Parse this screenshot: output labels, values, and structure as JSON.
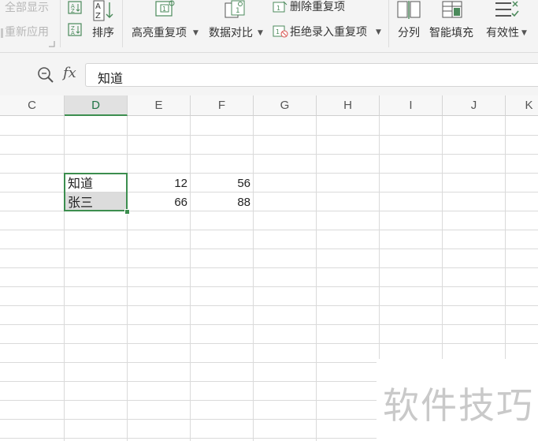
{
  "ribbon": {
    "show_all": "全部显示",
    "reapply": "重新应用",
    "sort": "排序",
    "highlight_duplicates": "高亮重复项",
    "compare": "数据对比",
    "remove_duplicates": "删除重复项",
    "reject_duplicates": "拒绝录入重复项",
    "split": "分列",
    "smart_fill": "智能填充",
    "validity": "有效性"
  },
  "formula_bar": {
    "fx_label": "fx",
    "content": "知道"
  },
  "columns": [
    "C",
    "D",
    "E",
    "F",
    "G",
    "H",
    "I",
    "J",
    "K"
  ],
  "selected_column": "D",
  "cells": {
    "D1": "知道",
    "E1": "12",
    "F1": "56",
    "D2": "张三",
    "E2": "66",
    "F2": "88"
  },
  "watermark": "软件技巧"
}
